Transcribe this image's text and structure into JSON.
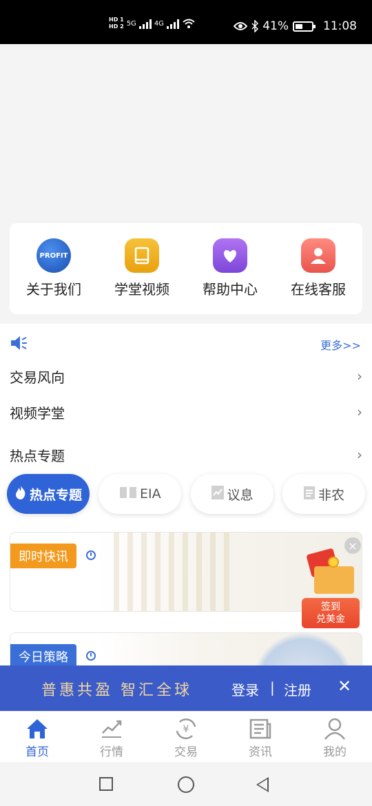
{
  "status_bar": {
    "hd1": "HD 1",
    "hd2": "HD 2",
    "net1": "5G",
    "net2": "4G",
    "battery": "41%",
    "time": "11:08"
  },
  "quick_entries": [
    {
      "label": "关于我们",
      "icon": "profit-icon",
      "badge": "PROFIT"
    },
    {
      "label": "学堂视频",
      "icon": "book-icon"
    },
    {
      "label": "帮助中心",
      "icon": "heart-chat-icon"
    },
    {
      "label": "在线客服",
      "icon": "user-service-icon"
    }
  ],
  "notice": {
    "more": "更多>>"
  },
  "list": [
    {
      "label": "交易风向"
    },
    {
      "label": "视频学堂"
    },
    {
      "label": "热点专题"
    }
  ],
  "tabs": [
    {
      "label": "热点专题",
      "icon": "flame-icon",
      "active": true
    },
    {
      "label": "EIA",
      "icon": "book-open-icon",
      "active": false
    },
    {
      "label": "议息",
      "icon": "chart-doc-icon",
      "active": false
    },
    {
      "label": "非农",
      "icon": "clipboard-icon",
      "active": false
    }
  ],
  "cards": [
    {
      "tag": "即时快讯"
    },
    {
      "tag": "今日策略"
    }
  ],
  "gift": {
    "line1": "签到",
    "line2": "兑美金"
  },
  "login_bar": {
    "slogan": "普惠共盈 智汇全球",
    "login": "登录",
    "separator": "|",
    "register": "注册"
  },
  "bottom_nav": [
    {
      "label": "首页",
      "icon": "home-icon",
      "active": true
    },
    {
      "label": "行情",
      "icon": "trend-icon",
      "active": false
    },
    {
      "label": "交易",
      "icon": "yuan-exchange-icon",
      "active": false
    },
    {
      "label": "资讯",
      "icon": "news-icon",
      "active": false
    },
    {
      "label": "我的",
      "icon": "person-icon",
      "active": false
    }
  ],
  "colors": {
    "primary": "#2f63d8",
    "accent_orange": "#f39a1e",
    "login_bar": "#3b5bc8"
  }
}
